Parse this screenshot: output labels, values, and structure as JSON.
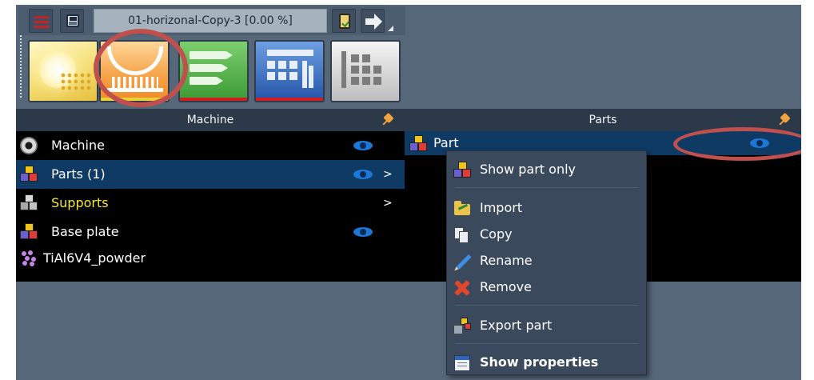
{
  "window": {
    "title": "01-horizonal-Copy-3 [0.00 %]"
  },
  "toolbar": {
    "menu_icon": "hamburger-menu-icon",
    "save_icon": "floppy-save-icon",
    "clipboard_icon": "clipboard-check-icon",
    "next_icon": "arrow-right-icon"
  },
  "modules": [
    {
      "name": "build-environment",
      "icon": "sun-powder-icon",
      "colors": [
        "#fff8c8",
        "#e7c13d"
      ],
      "underline": ""
    },
    {
      "name": "machine-parts",
      "icon": "platform-arc-icon",
      "colors": [
        "#ffd79a",
        "#ef8a27"
      ],
      "underline": "#e8d23a",
      "highlighted": true
    },
    {
      "name": "process-list",
      "icon": "arrow-rows-icon",
      "colors": [
        "#7ccf6e",
        "#3c9a35"
      ],
      "underline": "#d11d1d"
    },
    {
      "name": "slicing-grid",
      "icon": "grid-bars-icon",
      "colors": [
        "#6d9fe0",
        "#2454a8"
      ],
      "underline": "#d11d1d"
    },
    {
      "name": "report",
      "icon": "gray-grid-icon",
      "colors": [
        "#f4f4f4",
        "#bdbdbd"
      ],
      "underline": ""
    }
  ],
  "machine_panel": {
    "header": "Machine",
    "items": [
      {
        "label": "Machine",
        "icon": "gear-icon",
        "visible": true,
        "expandable": false,
        "color": "#ffffff"
      },
      {
        "label": "Parts (1)",
        "icon": "cubes-icon",
        "visible": true,
        "expandable": true,
        "chevron": ">",
        "color": "#ffffff",
        "selected": true
      },
      {
        "label": "Supports",
        "icon": "gray-cubes-icon",
        "visible": false,
        "expandable": true,
        "chevron": ">",
        "color": "#f4e83a"
      },
      {
        "label": "Base plate",
        "icon": "cubes-icon",
        "visible": true,
        "expandable": false,
        "color": "#ffffff"
      },
      {
        "label": "TiAl6V4_powder",
        "icon": "powder-icon",
        "visible": false,
        "expandable": false,
        "color": "#ffffff"
      }
    ]
  },
  "parts_panel": {
    "header": "Parts",
    "items": [
      {
        "label": "Part",
        "icon": "cubes-icon",
        "visible": true,
        "selected": true
      }
    ]
  },
  "context_menu": {
    "items": [
      {
        "label": "Show part only",
        "icon": "cubes-icon",
        "bold": false
      },
      {
        "separator": true
      },
      {
        "label": "Import",
        "icon": "folder-import-icon",
        "bold": false
      },
      {
        "label": "Copy",
        "icon": "copy-icon",
        "bold": false
      },
      {
        "label": "Rename",
        "icon": "pencil-icon",
        "bold": false
      },
      {
        "label": "Remove",
        "icon": "red-x-icon",
        "bold": false
      },
      {
        "separator": true
      },
      {
        "label": "Export part",
        "icon": "export-icon",
        "bold": false
      },
      {
        "separator": true
      },
      {
        "label": "Show properties",
        "icon": "properties-icon",
        "bold": true
      }
    ]
  },
  "colors": {
    "background": "#56677a",
    "panel_header": "#2b3948",
    "list_background": "#000000",
    "selection": "#0e3a64",
    "eye": "#1c78d6",
    "highlight_annotation": "#c0504d"
  }
}
